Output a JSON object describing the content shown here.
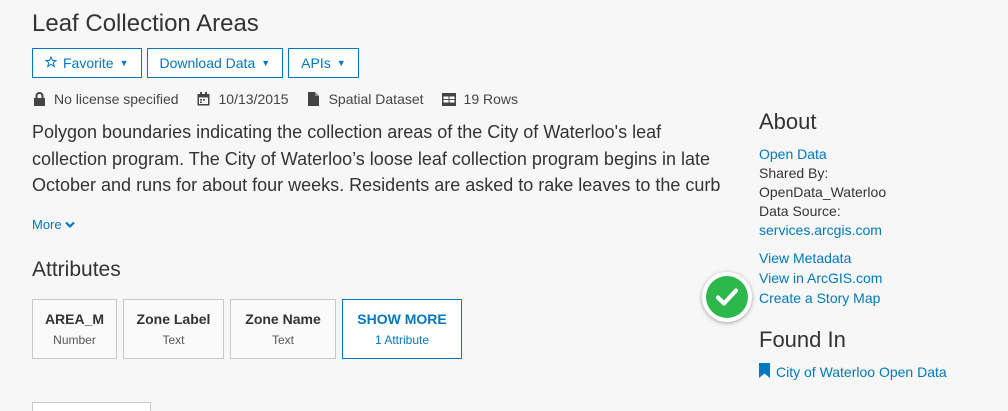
{
  "page": {
    "title": "Leaf Collection Areas"
  },
  "toolbar": {
    "favorite_label": "Favorite",
    "download_label": "Download Data",
    "apis_label": "APIs"
  },
  "meta": {
    "license": "No license specified",
    "date": "10/13/2015",
    "dataset_type": "Spatial Dataset",
    "rows": "19 Rows"
  },
  "description": {
    "text": "Polygon boundaries indicating the collection areas of the City of Waterloo's leaf collection program. The City of Waterloo’s loose leaf collection program begins in late October and runs for about four weeks. Residents are asked to rake leaves to the curb on the scheduled date and the collection trucks will pick them up.",
    "more_label": "More"
  },
  "attributes": {
    "heading": "Attributes",
    "cards": [
      {
        "name": "AREA_M",
        "type": "Number"
      },
      {
        "name": "Zone Label",
        "type": "Text"
      },
      {
        "name": "Zone Name",
        "type": "Text"
      }
    ],
    "show_more_label": "SHOW MORE",
    "show_more_count": "1 Attribute"
  },
  "about": {
    "heading": "About",
    "open_data": "Open Data",
    "shared_by_label": "Shared By:",
    "shared_by_value": "OpenData_Waterloo",
    "data_source_label": "Data Source:",
    "data_source_value": "services.arcgis.com",
    "view_metadata": "View Metadata",
    "view_arcgis": "View in ArcGIS.com",
    "story_map": "Create a Story Map"
  },
  "found_in": {
    "heading": "Found In",
    "link": "City of Waterloo Open Data"
  },
  "icons": {
    "favorite": "star-outline-icon",
    "license": "lock-icon",
    "date": "calendar-icon",
    "dataset": "document-icon",
    "rows": "table-icon",
    "more": "chevron-down-icon",
    "found_in": "bookmark-icon",
    "checkmark": "check-circle-icon"
  },
  "colors": {
    "accent": "#0079c1",
    "check_green": "#2db84b",
    "background": "#f7f7f7"
  }
}
